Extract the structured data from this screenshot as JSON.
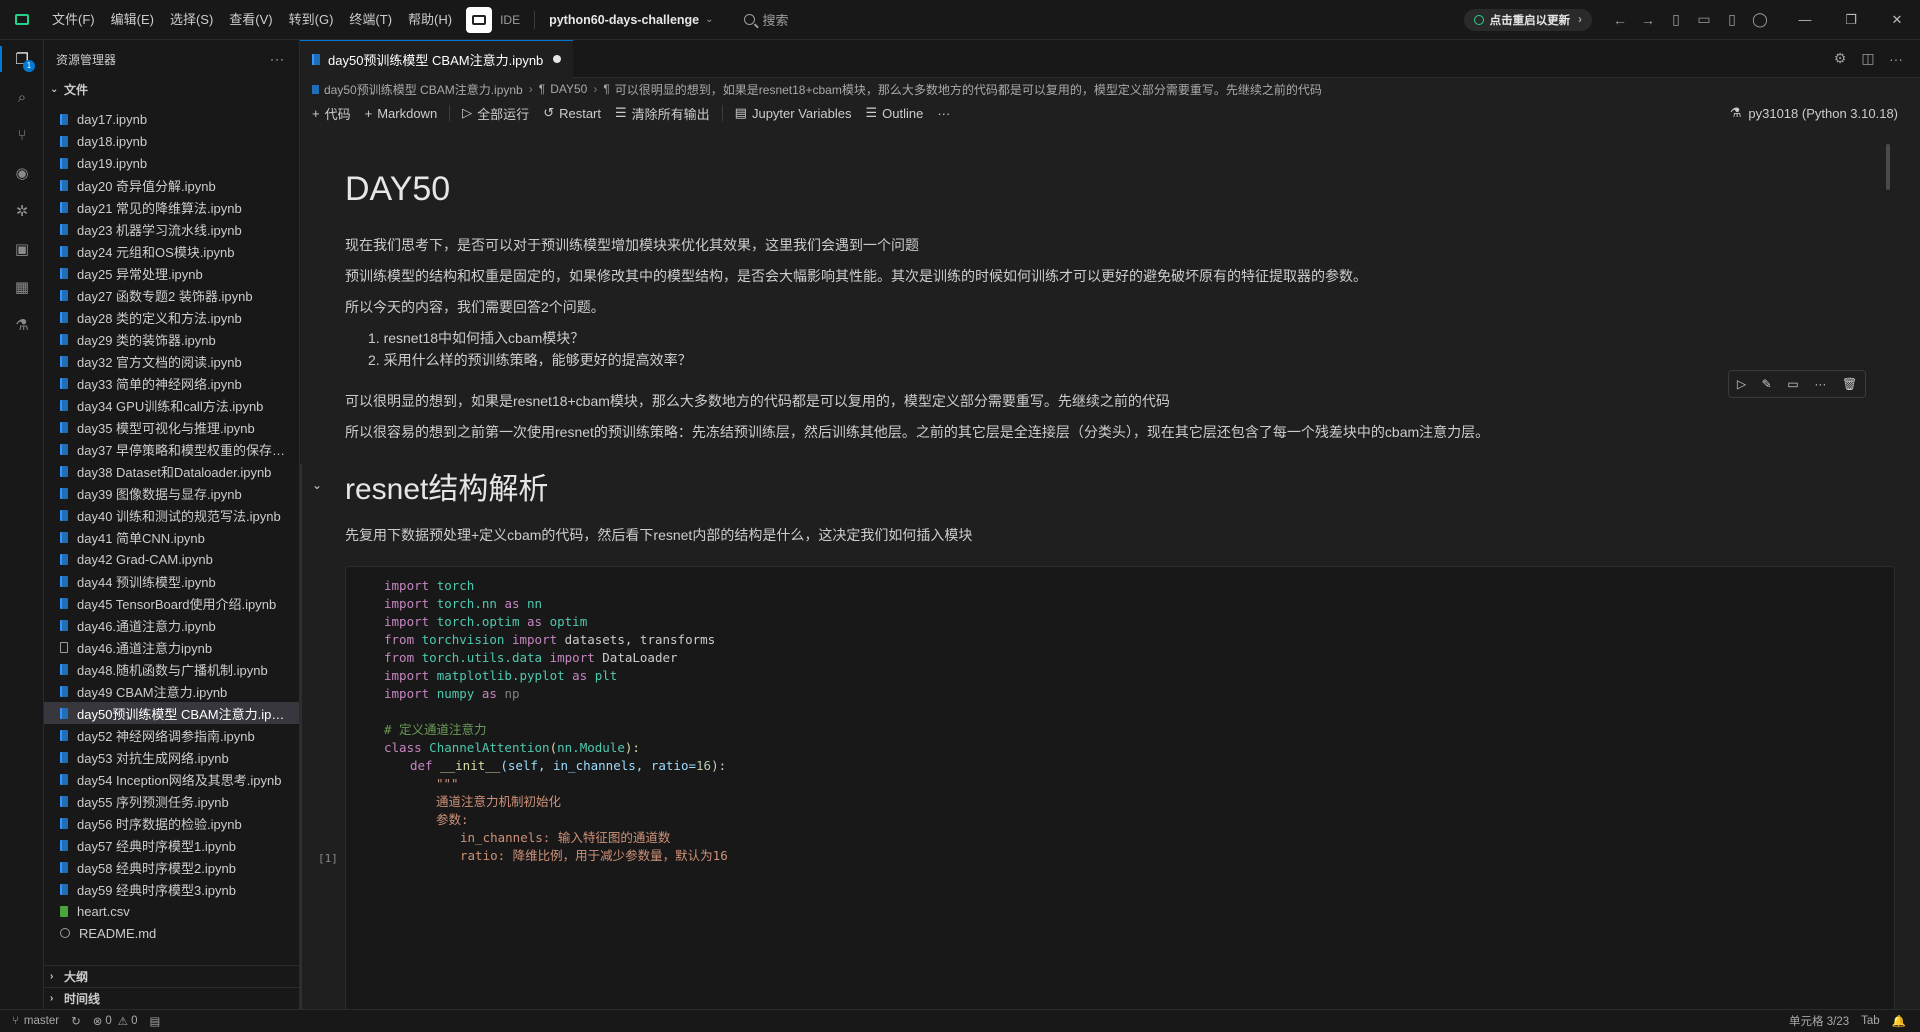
{
  "menu": [
    "文件(F)",
    "编辑(E)",
    "选择(S)",
    "查看(V)",
    "转到(G)",
    "终端(T)",
    "帮助(H)"
  ],
  "ide_label": "IDE",
  "project": "python60-days-challenge",
  "search_placeholder": "搜索",
  "restart_update": "点击重启以更新",
  "sidebar": {
    "title": "资源管理器",
    "section_files": "文件",
    "section_outline": "大纲",
    "section_timeline": "时间线",
    "files": [
      {
        "name": "day17.ipynb",
        "type": "nb"
      },
      {
        "name": "day18.ipynb",
        "type": "nb"
      },
      {
        "name": "day19.ipynb",
        "type": "nb"
      },
      {
        "name": "day20 奇异值分解.ipynb",
        "type": "nb"
      },
      {
        "name": "day21 常见的降维算法.ipynb",
        "type": "nb"
      },
      {
        "name": "day23 机器学习流水线.ipynb",
        "type": "nb"
      },
      {
        "name": "day24 元组和OS模块.ipynb",
        "type": "nb"
      },
      {
        "name": "day25 异常处理.ipynb",
        "type": "nb"
      },
      {
        "name": "day27 函数专题2 装饰器.ipynb",
        "type": "nb"
      },
      {
        "name": "day28 类的定义和方法.ipynb",
        "type": "nb"
      },
      {
        "name": "day29 类的装饰器.ipynb",
        "type": "nb"
      },
      {
        "name": "day32 官方文档的阅读.ipynb",
        "type": "nb"
      },
      {
        "name": "day33 简单的神经网络.ipynb",
        "type": "nb"
      },
      {
        "name": "day34 GPU训练和call方法.ipynb",
        "type": "nb"
      },
      {
        "name": "day35 模型可视化与推理.ipynb",
        "type": "nb"
      },
      {
        "name": "day37 早停策略和模型权重的保存.i...",
        "type": "nb"
      },
      {
        "name": "day38 Dataset和Dataloader.ipynb",
        "type": "nb"
      },
      {
        "name": "day39 图像数据与显存.ipynb",
        "type": "nb"
      },
      {
        "name": "day40 训练和测试的规范写法.ipynb",
        "type": "nb"
      },
      {
        "name": "day41 简单CNN.ipynb",
        "type": "nb"
      },
      {
        "name": "day42 Grad-CAM.ipynb",
        "type": "nb"
      },
      {
        "name": "day44 预训练模型.ipynb",
        "type": "nb"
      },
      {
        "name": "day45 TensorBoard使用介绍.ipynb",
        "type": "nb"
      },
      {
        "name": "day46.通道注意力.ipynb",
        "type": "nb"
      },
      {
        "name": "day46.通道注意力ipynb",
        "type": "plain"
      },
      {
        "name": "day48.随机函数与广播机制.ipynb",
        "type": "nb"
      },
      {
        "name": "day49 CBAM注意力.ipynb",
        "type": "nb"
      },
      {
        "name": "day50预训练模型 CBAM注意力.ipy...",
        "type": "nb",
        "selected": true
      },
      {
        "name": "day52 神经网络调参指南.ipynb",
        "type": "nb"
      },
      {
        "name": "day53 对抗生成网络.ipynb",
        "type": "nb"
      },
      {
        "name": "day54 Inception网络及其思考.ipynb",
        "type": "nb"
      },
      {
        "name": "day55 序列预测任务.ipynb",
        "type": "nb"
      },
      {
        "name": "day56 时序数据的检验.ipynb",
        "type": "nb"
      },
      {
        "name": "day57 经典时序模型1.ipynb",
        "type": "nb"
      },
      {
        "name": "day58 经典时序模型2.ipynb",
        "type": "nb"
      },
      {
        "name": "day59 经典时序模型3.ipynb",
        "type": "nb"
      },
      {
        "name": "heart.csv",
        "type": "csv"
      },
      {
        "name": "README.md",
        "type": "info"
      }
    ]
  },
  "tab": {
    "title": "day50预训练模型 CBAM注意力.ipynb"
  },
  "breadcrumb": [
    "day50预训练模型 CBAM注意力.ipynb",
    "DAY50",
    "可以很明显的想到，如果是resnet18+cbam模块，那么大多数地方的代码都是可以复用的，模型定义部分需要重写。先继续之前的代码"
  ],
  "toolbar": {
    "code": "代码",
    "markdown": "Markdown",
    "run_all": "全部运行",
    "restart": "Restart",
    "clear_outputs": "清除所有输出",
    "variables": "Jupyter Variables",
    "outline": "Outline",
    "kernel": "py31018 (Python 3.10.18)"
  },
  "notebook": {
    "h1": "DAY50",
    "p1": "现在我们思考下，是否可以对于预训练模型增加模块来优化其效果，这里我们会遇到一个问题",
    "p2": "预训练模型的结构和权重是固定的，如果修改其中的模型结构，是否会大幅影响其性能。其次是训练的时候如何训练才可以更好的避免破坏原有的特征提取器的参数。",
    "p3": "所以今天的内容，我们需要回答2个问题。",
    "list": [
      "1. resnet18中如何插入cbam模块？",
      "2. 采用什么样的预训练策略，能够更好的提高效率？"
    ],
    "p4": "可以很明显的想到，如果是resnet18+cbam模块，那么大多数地方的代码都是可以复用的，模型定义部分需要重写。先继续之前的代码",
    "p5": "所以很容易的想到之前第一次使用resnet的预训练策略：先冻结预训练层，然后训练其他层。之前的其它层是全连接层（分类头），现在其它层还包含了每一个残差块中的cbam注意力层。",
    "h2": "resnet结构解析",
    "p6": "先复用下数据预处理+定义cbam的代码，然后看下resnet内部的结构是什么，这决定我们如何插入模块",
    "exec_count": "[1]",
    "code": {
      "l1": [
        "import",
        "torch"
      ],
      "l2": [
        "import",
        "torch.nn",
        "as",
        "nn"
      ],
      "l3": [
        "import",
        "torch.optim",
        "as",
        "optim"
      ],
      "l4": [
        "from",
        "torchvision",
        "import",
        "datasets, transforms"
      ],
      "l5": [
        "from",
        "torch.utils.data",
        "import",
        "DataLoader"
      ],
      "l6": [
        "import",
        "matplotlib.pyplot",
        "as",
        "plt"
      ],
      "l7": [
        "import",
        "numpy",
        "as",
        "np"
      ],
      "l8": "# 定义通道注意力",
      "l9": [
        "class",
        "ChannelAttention",
        "(",
        "nn.Module",
        "):"
      ],
      "l10": [
        "def",
        "__init__",
        "(self, in_channels, ratio=",
        "16",
        "):"
      ],
      "l11": "\"\"\"",
      "l12": "通道注意力机制初始化",
      "l13": "参数:",
      "l14": "in_channels: 输入特征图的通道数",
      "l15": "ratio: 降维比例，用于减少参数量，默认为16"
    }
  },
  "status": {
    "branch": "master",
    "errors": "0",
    "warnings": "0",
    "cell": "单元格 3/23",
    "tab": "Tab"
  }
}
